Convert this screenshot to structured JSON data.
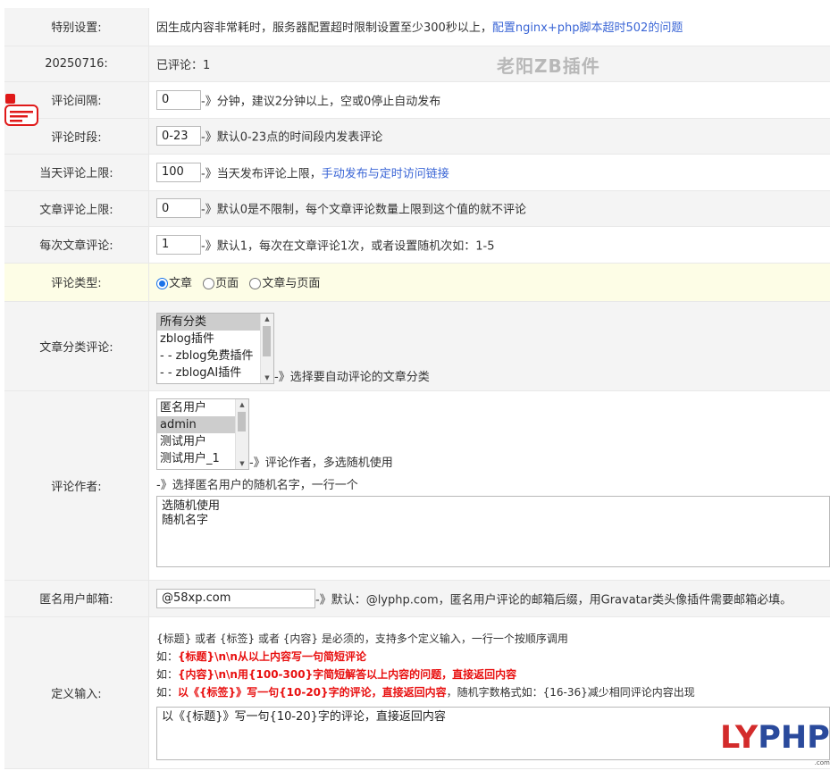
{
  "rows": {
    "special": {
      "label": "特别设置:",
      "text": "因生成内容非常耗时，服务器配置超时限制设置至少300秒以上，",
      "link": "配置nginx+php脚本超时502的问题"
    },
    "date": {
      "label": "20250716:",
      "text": "已评论：1"
    },
    "interval": {
      "label": "评论间隔:",
      "value": "0",
      "note": "-》分钟，建议2分钟以上，空或0停止自动发布"
    },
    "hours": {
      "label": "评论时段:",
      "value": "0-23",
      "note": "-》默认0-23点的时间段内发表评论"
    },
    "daily_limit": {
      "label": "当天评论上限:",
      "value": "100",
      "note": "-》当天发布评论上限，",
      "link": "手动发布与定时访问链接"
    },
    "post_limit": {
      "label": "文章评论上限:",
      "value": "0",
      "note": "-》默认0是不限制，每个文章评论数量上限到这个值的就不评论"
    },
    "per_time": {
      "label": "每次文章评论:",
      "value": "1",
      "note": "-》默认1，每次在文章评论1次，或者设置随机次如：1-5"
    },
    "type": {
      "label": "评论类型:",
      "options": [
        "文章",
        "页面",
        "文章与页面"
      ],
      "selected": "文章"
    },
    "category": {
      "label": "文章分类评论:",
      "options": [
        "所有分类",
        "zblog插件",
        "- - zblog免费插件",
        "- - zblogAI插件"
      ],
      "selected": "所有分类",
      "note": "-》选择要自动评论的文章分类"
    },
    "author": {
      "label": "评论作者:",
      "options": [
        "匿名用户",
        "admin",
        "测试用户",
        "测试用户_1"
      ],
      "selected": "admin",
      "note": "-》评论作者，多选随机使用",
      "sub_note": "-》选择匿名用户的随机名字，一行一个",
      "textarea": "选随机使用\n随机名字"
    },
    "email": {
      "label": "匿名用户邮箱:",
      "value": "@58xp.com",
      "note": "-》默认：@lyphp.com，匿名用户评论的邮箱后缀，用Gravatar类头像插件需要邮箱必填。"
    },
    "custom": {
      "label": "定义输入:",
      "line1": "{标题} 或者 {标签} 或者 {内容} 是必须的，支持多个定义输入，一行一个按顺序调用",
      "ex_prefix": "如：",
      "ex1": "{标题}\\n\\n从以上内容写一句简短评论",
      "ex2": "{内容}\\n\\n用{100-300}字简短解答以上内容的问题，直接返回内容",
      "ex3": "以《{标签}》写一句{10-20}字的评论，直接返回内容",
      "ex3_tail": "，随机字数格式如：{16-36}减少相同评论内容出现",
      "textarea": "以《{标题}》写一句{10-20}字的评论，直接返回内容"
    }
  },
  "watermark": "老阳ZB插件",
  "logo": {
    "ly": "LY",
    "php": "PHP",
    "suffix": ".com"
  },
  "colors": {
    "link": "#3b66d6",
    "red": "#e81010",
    "yellow_row": "#fdfde6",
    "label_bg": "#f4f4f4"
  }
}
